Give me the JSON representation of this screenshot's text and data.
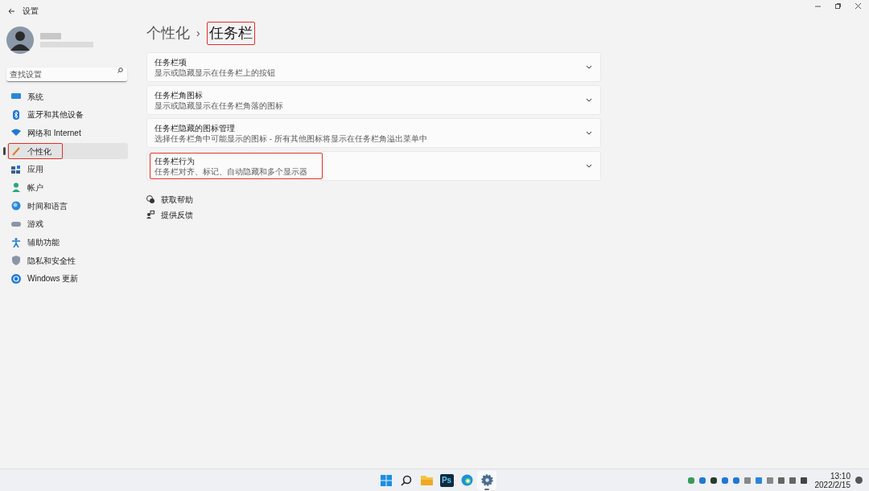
{
  "window": {
    "title": "设置"
  },
  "search": {
    "placeholder": "查找设置"
  },
  "sidebar": {
    "items": [
      {
        "label": "系统",
        "selected": false,
        "highlighted": false
      },
      {
        "label": "蓝牙和其他设备",
        "selected": false,
        "highlighted": false
      },
      {
        "label": "网络和 Internet",
        "selected": false,
        "highlighted": false
      },
      {
        "label": "个性化",
        "selected": true,
        "highlighted": true
      },
      {
        "label": "应用",
        "selected": false,
        "highlighted": false
      },
      {
        "label": "帐户",
        "selected": false,
        "highlighted": false
      },
      {
        "label": "时间和语言",
        "selected": false,
        "highlighted": false
      },
      {
        "label": "游戏",
        "selected": false,
        "highlighted": false
      },
      {
        "label": "辅助功能",
        "selected": false,
        "highlighted": false
      },
      {
        "label": "隐私和安全性",
        "selected": false,
        "highlighted": false
      },
      {
        "label": "Windows 更新",
        "selected": false,
        "highlighted": false
      }
    ]
  },
  "breadcrumb": {
    "parent": "个性化",
    "separator": "›",
    "current": "任务栏",
    "highlighted": true
  },
  "cards": [
    {
      "title": "任务栏项",
      "subtitle": "显示或隐藏显示在任务栏上的按钮",
      "highlighted": false
    },
    {
      "title": "任务栏角图标",
      "subtitle": "显示或隐藏显示在任务栏角落的图标",
      "highlighted": false
    },
    {
      "title": "任务栏隐藏的图标管理",
      "subtitle": "选择任务栏角中可能显示的图标 - 所有其他图标将显示在任务栏角溢出菜单中",
      "highlighted": false
    },
    {
      "title": "任务栏行为",
      "subtitle": "任务栏对齐、标记、自动隐藏和多个显示器",
      "highlighted": true
    }
  ],
  "links": [
    {
      "label": "获取帮助"
    },
    {
      "label": "提供反馈"
    }
  ],
  "taskbar": {
    "apps": [
      {
        "kind": "start"
      },
      {
        "kind": "search"
      },
      {
        "kind": "folder"
      },
      {
        "kind": "ps",
        "label": "Ps"
      },
      {
        "kind": "edge"
      },
      {
        "kind": "settings",
        "selected": true
      }
    ],
    "clock": {
      "time": "13:10",
      "date": "2022/2/15"
    }
  }
}
